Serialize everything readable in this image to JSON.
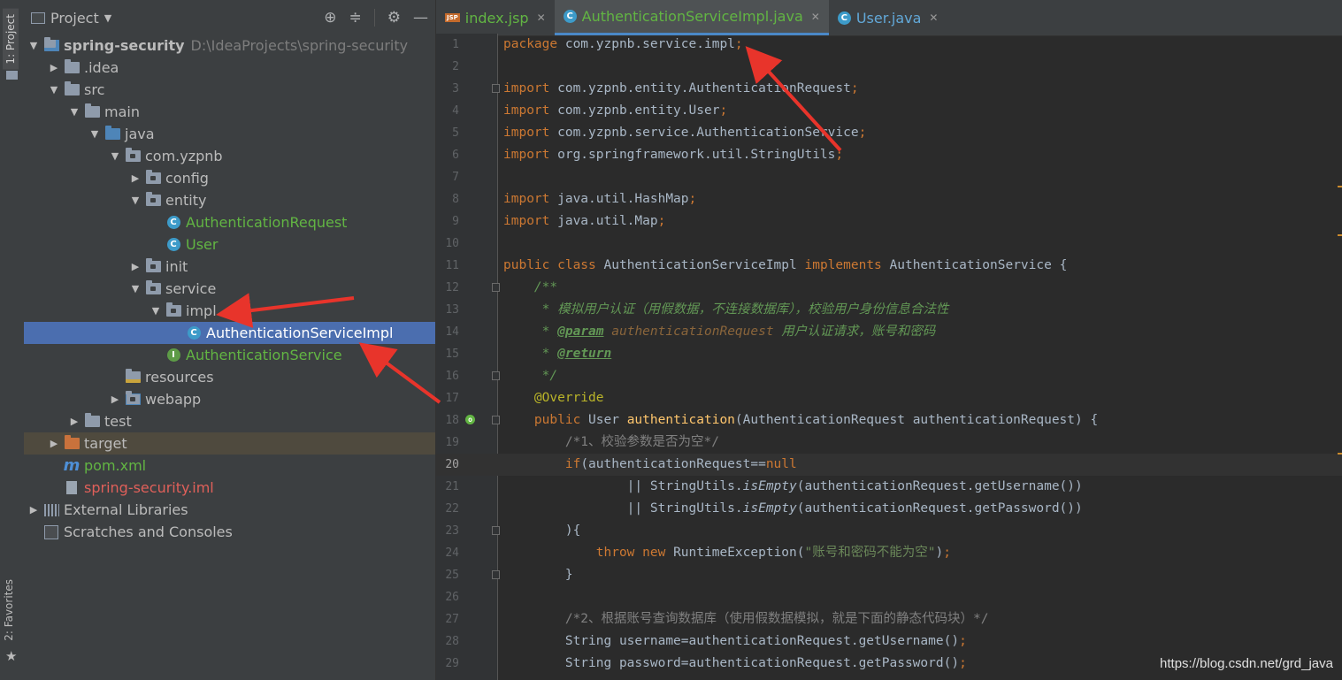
{
  "sidebar_strip": {
    "project_tab": "1: Project",
    "favorites_tab": "2: Favorites"
  },
  "project_panel": {
    "title": "Project",
    "tree": [
      {
        "label": "spring-security",
        "path": "D:\\IdeaProjects\\spring-security",
        "depth": 0,
        "expanded": true,
        "icon": "module-folder-icon",
        "style": "bold"
      },
      {
        "label": ".idea",
        "depth": 1,
        "expanded": false,
        "icon": "folder-icon"
      },
      {
        "label": "src",
        "depth": 1,
        "expanded": true,
        "icon": "folder-icon"
      },
      {
        "label": "main",
        "depth": 2,
        "expanded": true,
        "icon": "folder-icon"
      },
      {
        "label": "java",
        "depth": 3,
        "expanded": true,
        "icon": "source-folder-icon"
      },
      {
        "label": "com.yzpnb",
        "depth": 4,
        "expanded": true,
        "icon": "package-icon"
      },
      {
        "label": "config",
        "depth": 5,
        "expanded": false,
        "icon": "package-icon"
      },
      {
        "label": "entity",
        "depth": 5,
        "expanded": true,
        "icon": "package-icon"
      },
      {
        "label": "AuthenticationRequest",
        "depth": 6,
        "icon": "class-icon",
        "style": "green"
      },
      {
        "label": "User",
        "depth": 6,
        "icon": "class-icon",
        "style": "green"
      },
      {
        "label": "init",
        "depth": 5,
        "expanded": false,
        "icon": "package-icon"
      },
      {
        "label": "service",
        "depth": 5,
        "expanded": true,
        "icon": "package-icon"
      },
      {
        "label": "impl",
        "depth": 6,
        "expanded": true,
        "icon": "package-icon"
      },
      {
        "label": "AuthenticationServiceImpl",
        "depth": 7,
        "icon": "class-icon",
        "style": "selected"
      },
      {
        "label": "AuthenticationService",
        "depth": 6,
        "icon": "interface-icon",
        "style": "green"
      },
      {
        "label": "resources",
        "depth": 4,
        "icon": "resources-folder-icon"
      },
      {
        "label": "webapp",
        "depth": 4,
        "expanded": false,
        "icon": "web-folder-icon"
      },
      {
        "label": "test",
        "depth": 2,
        "expanded": false,
        "icon": "folder-icon"
      },
      {
        "label": "target",
        "depth": 1,
        "expanded": false,
        "icon": "excluded-folder-icon",
        "style": "target"
      },
      {
        "label": "pom.xml",
        "depth": 1,
        "icon": "maven-icon",
        "style": "green"
      },
      {
        "label": "spring-security.iml",
        "depth": 1,
        "icon": "iml-file-icon",
        "style": "red"
      },
      {
        "label": "External Libraries",
        "depth": 0,
        "expanded": false,
        "icon": "libraries-icon"
      },
      {
        "label": "Scratches and Consoles",
        "depth": 0,
        "icon": "scratches-icon"
      }
    ]
  },
  "tabs": [
    {
      "label": "index.jsp",
      "icon": "jsp-icon",
      "color": "green",
      "active": false
    },
    {
      "label": "AuthenticationServiceImpl.java",
      "icon": "class-icon",
      "color": "green",
      "active": true
    },
    {
      "label": "User.java",
      "icon": "class-icon",
      "color": "blue",
      "active": false
    }
  ],
  "code_lines": [
    [
      [
        "k",
        "package "
      ],
      [
        "t",
        "com.yzpnb.service.impl"
      ],
      [
        "k",
        ";"
      ]
    ],
    [],
    [
      [
        "k",
        "import "
      ],
      [
        "t",
        "com.yzpnb.entity.AuthenticationRequest"
      ],
      [
        "k",
        ";"
      ]
    ],
    [
      [
        "k",
        "import "
      ],
      [
        "t",
        "com.yzpnb.entity.User"
      ],
      [
        "k",
        ";"
      ]
    ],
    [
      [
        "k",
        "import "
      ],
      [
        "t",
        "com.yzpnb.service.AuthenticationService"
      ],
      [
        "k",
        ";"
      ]
    ],
    [
      [
        "k",
        "import "
      ],
      [
        "t",
        "org.springframework.util.StringUtils"
      ],
      [
        "k",
        ";"
      ]
    ],
    [],
    [
      [
        "k",
        "import "
      ],
      [
        "t",
        "java.util.HashMap"
      ],
      [
        "k",
        ";"
      ]
    ],
    [
      [
        "k",
        "import "
      ],
      [
        "t",
        "java.util.Map"
      ],
      [
        "k",
        ";"
      ]
    ],
    [],
    [
      [
        "k",
        "public class "
      ],
      [
        "t",
        "AuthenticationServiceImpl "
      ],
      [
        "k",
        "implements "
      ],
      [
        "t",
        "AuthenticationService {"
      ]
    ],
    [
      [
        "t",
        "    "
      ],
      [
        "doc",
        "/**"
      ]
    ],
    [
      [
        "t",
        "     "
      ],
      [
        "doc",
        "* 模拟用户认证（用假数据，不连接数据库），校验用户身份信息合法性"
      ]
    ],
    [
      [
        "t",
        "     "
      ],
      [
        "doc",
        "* "
      ],
      [
        "doctag",
        "@param"
      ],
      [
        "doc",
        " "
      ],
      [
        "docparam",
        "authenticationRequest"
      ],
      [
        "doc",
        " 用户认证请求，账号和密码"
      ]
    ],
    [
      [
        "t",
        "     "
      ],
      [
        "doc",
        "* "
      ],
      [
        "doctag",
        "@return"
      ]
    ],
    [
      [
        "t",
        "     "
      ],
      [
        "doc",
        "*/"
      ]
    ],
    [
      [
        "t",
        "    "
      ],
      [
        "ann",
        "@Override"
      ]
    ],
    [
      [
        "t",
        "    "
      ],
      [
        "k",
        "public "
      ],
      [
        "t",
        "User "
      ],
      [
        "fn",
        "authentication"
      ],
      [
        "t",
        "(AuthenticationRequest authenticationRequest) {"
      ]
    ],
    [
      [
        "t",
        "        "
      ],
      [
        "cm",
        "/*1、校验参数是否为空*/"
      ]
    ],
    [
      [
        "t",
        "        "
      ],
      [
        "k",
        "if"
      ],
      [
        "t",
        "(authenticationRequest=="
      ],
      [
        "k",
        "null"
      ]
    ],
    [
      [
        "t",
        "                || StringUtils."
      ],
      [
        "it",
        "isEmpty"
      ],
      [
        "t",
        "(authenticationRequest.getUsername())"
      ]
    ],
    [
      [
        "t",
        "                || StringUtils."
      ],
      [
        "it",
        "isEmpty"
      ],
      [
        "t",
        "(authenticationRequest.getPassword())"
      ]
    ],
    [
      [
        "t",
        "        ){"
      ]
    ],
    [
      [
        "t",
        "            "
      ],
      [
        "k",
        "throw new "
      ],
      [
        "t",
        "RuntimeException("
      ],
      [
        "str",
        "\"账号和密码不能为空\""
      ],
      [
        "t",
        ")"
      ],
      [
        "k",
        ";"
      ]
    ],
    [
      [
        "t",
        "        }"
      ]
    ],
    [],
    [
      [
        "t",
        "        "
      ],
      [
        "cm",
        "/*2、根据账号查询数据库（使用假数据模拟，就是下面的静态代码块）*/"
      ]
    ],
    [
      [
        "t",
        "        String username=authenticationRequest.getUsername()"
      ],
      [
        "k",
        ";"
      ]
    ],
    [
      [
        "t",
        "        String password=authenticationRequest.getPassword()"
      ],
      [
        "k",
        ";"
      ]
    ]
  ],
  "current_line": 20,
  "watermark": "https://blog.csdn.net/grd_java"
}
